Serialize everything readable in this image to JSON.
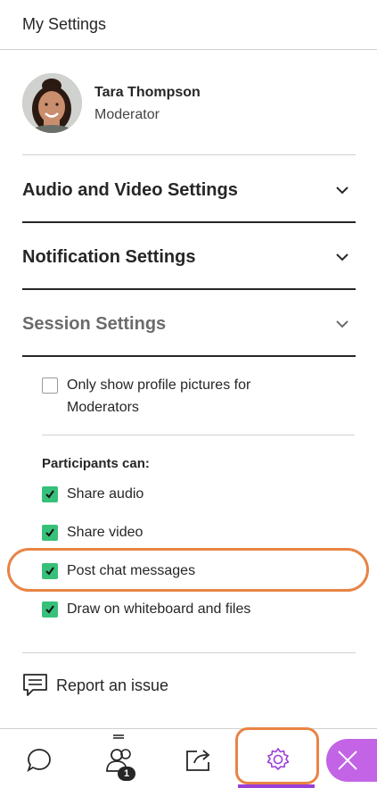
{
  "header": {
    "title": "My Settings"
  },
  "profile": {
    "name": "Tara Thompson",
    "role": "Moderator"
  },
  "sections": [
    {
      "label": "Audio and Video Settings",
      "expanded": false
    },
    {
      "label": "Notification Settings",
      "expanded": false
    },
    {
      "label": "Session Settings",
      "expanded": true
    }
  ],
  "session": {
    "profile_pictures": {
      "label_line1": "Only show profile pictures for",
      "label_line2": "Moderators",
      "checked": false
    },
    "participants_heading": "Participants can:",
    "options": [
      {
        "label": "Share audio",
        "checked": true
      },
      {
        "label": "Share video",
        "checked": true
      },
      {
        "label": "Post chat messages",
        "checked": true,
        "highlighted": true
      },
      {
        "label": "Draw on whiteboard and files",
        "checked": true
      }
    ]
  },
  "report": {
    "label": "Report an issue"
  },
  "tabbar": {
    "tabs": [
      {
        "icon": "chat-icon"
      },
      {
        "icon": "participants-icon",
        "badge": "1"
      },
      {
        "icon": "share-content-icon"
      },
      {
        "icon": "settings-gear-icon",
        "active": true
      }
    ],
    "close_icon": "close-icon"
  },
  "colors": {
    "accent_purple": "#9b3fd9",
    "close_button": "#c264e5",
    "checkbox_green": "#37c07a",
    "highlight_orange": "#e88445"
  }
}
